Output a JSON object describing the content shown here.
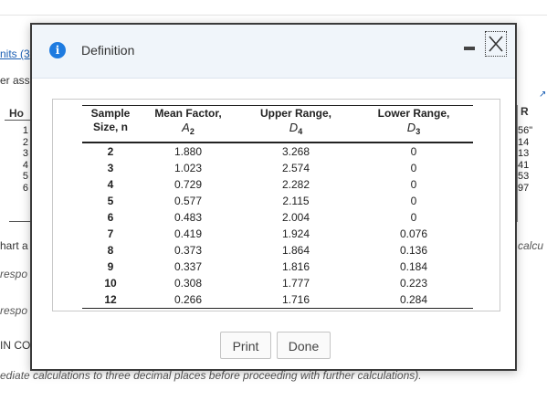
{
  "background": {
    "link_fragment": "nits (3",
    "text_fragment_1": "er ass",
    "header_ho": "Ho",
    "header_r": "R",
    "left_rows": [
      "1",
      "2",
      "3",
      "4",
      "5",
      "6"
    ],
    "right_rows": [
      "56\"",
      "14",
      "13",
      "41",
      "53",
      "97"
    ],
    "chart_fragment": "hart a",
    "calc_fragment": "calcu",
    "respo_1": "respo",
    "respo_2": "respo",
    "in_fragment": "IN CO",
    "bottom_note": "ediate calculations to three decimal places before proceeding with further calculations)."
  },
  "dialog": {
    "title": "Definition",
    "info_icon": "info-icon",
    "minimize_icon": "minimize-icon",
    "close_icon": "close-icon",
    "print_label": "Print",
    "done_label": "Done"
  },
  "table": {
    "headers": {
      "n_line1": "Sample",
      "n_line2": "Size, n",
      "a_line1": "Mean Factor,",
      "a_sym": "A",
      "a_sub": "2",
      "d4_line1": "Upper Range,",
      "d4_sym": "D",
      "d4_sub": "4",
      "d3_line1": "Lower Range,",
      "d3_sym": "D",
      "d3_sub": "3"
    },
    "rows": [
      {
        "n": "2",
        "a2": "1.880",
        "d4": "3.268",
        "d3": "0"
      },
      {
        "n": "3",
        "a2": "1.023",
        "d4": "2.574",
        "d3": "0"
      },
      {
        "n": "4",
        "a2": "0.729",
        "d4": "2.282",
        "d3": "0"
      },
      {
        "n": "5",
        "a2": "0.577",
        "d4": "2.115",
        "d3": "0"
      },
      {
        "n": "6",
        "a2": "0.483",
        "d4": "2.004",
        "d3": "0"
      },
      {
        "n": "7",
        "a2": "0.419",
        "d4": "1.924",
        "d3": "0.076"
      },
      {
        "n": "8",
        "a2": "0.373",
        "d4": "1.864",
        "d3": "0.136"
      },
      {
        "n": "9",
        "a2": "0.337",
        "d4": "1.816",
        "d3": "0.184"
      },
      {
        "n": "10",
        "a2": "0.308",
        "d4": "1.777",
        "d3": "0.223"
      },
      {
        "n": "12",
        "a2": "0.266",
        "d4": "1.716",
        "d3": "0.284"
      }
    ]
  },
  "colors": {
    "accent": "#1e7be0",
    "header_bg": "#f0f5fa",
    "dialog_border": "#3a3a3a"
  }
}
